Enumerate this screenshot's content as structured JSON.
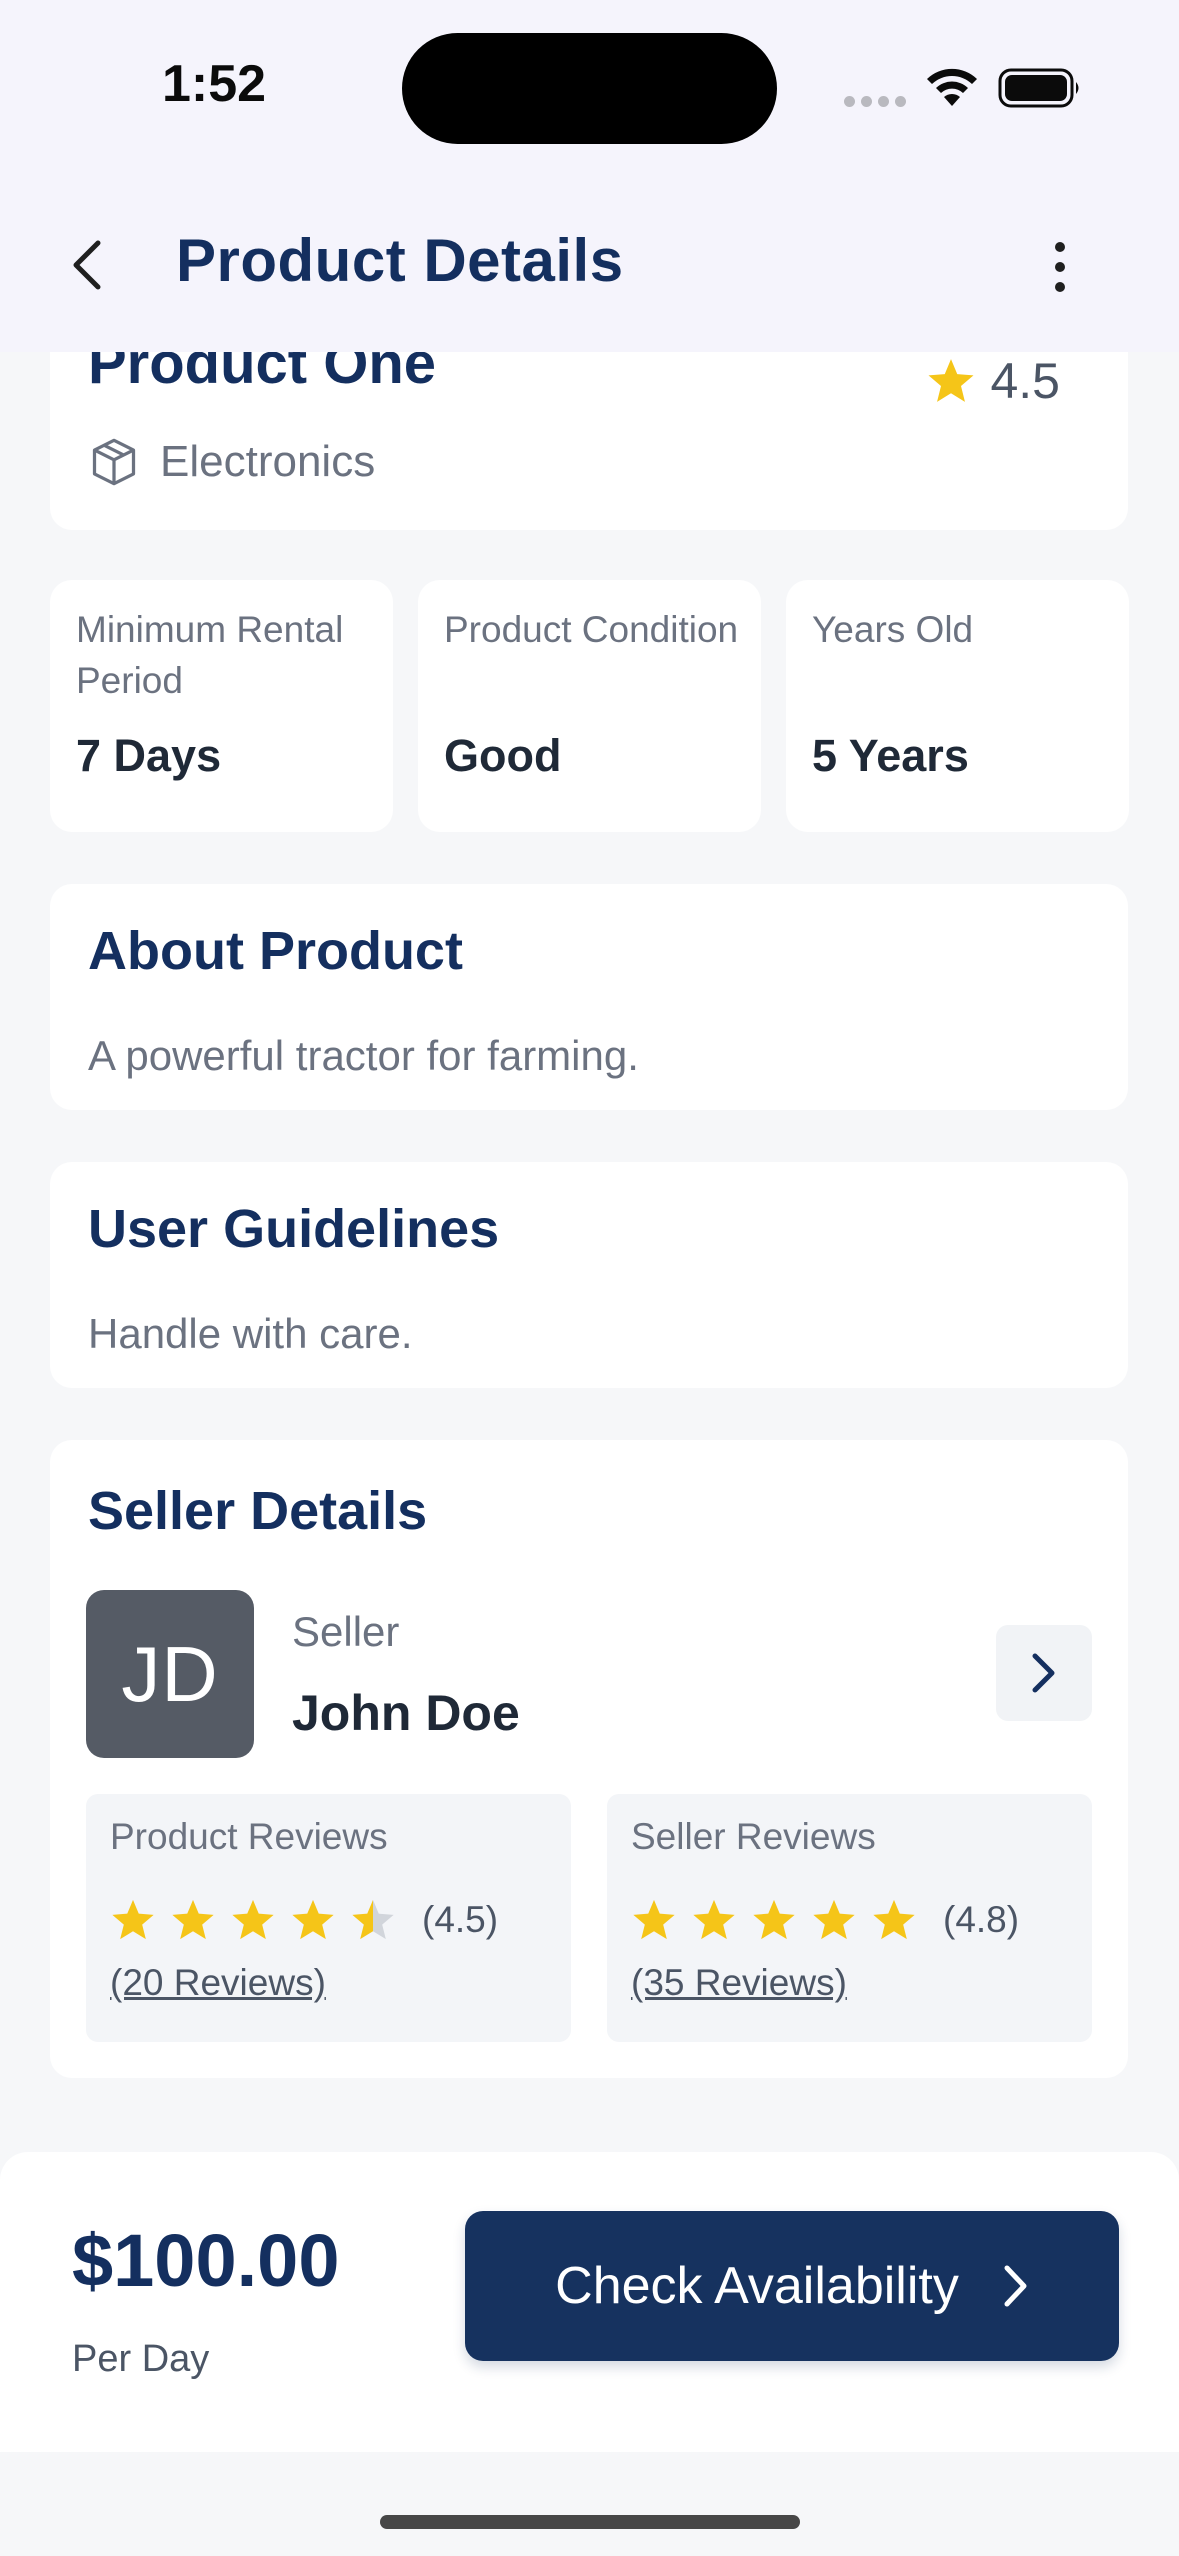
{
  "status_bar": {
    "time": "1:52"
  },
  "header": {
    "title": "Product Details",
    "back_icon": "chevron-left-icon",
    "menu_icon": "more-vertical-icon"
  },
  "product": {
    "name": "Product One",
    "rating": "4.5",
    "category": "Electronics"
  },
  "stats": [
    {
      "label": "Minimum Rental Period",
      "value": "7 Days"
    },
    {
      "label": "Product Condition",
      "value": "Good"
    },
    {
      "label": "Years Old",
      "value": "5 Years"
    }
  ],
  "about": {
    "title": "About Product",
    "text": "A powerful tractor for farming."
  },
  "guidelines": {
    "title": "User Guidelines",
    "text": "Handle with care."
  },
  "seller": {
    "title": "Seller Details",
    "initials": "JD",
    "role": "Seller",
    "name": "John Doe",
    "product_reviews": {
      "title": "Product Reviews",
      "score": "(4.5)",
      "count": "(20 Reviews)",
      "rating": 4.5
    },
    "seller_reviews": {
      "title": "Seller Reviews",
      "score": "(4.8)",
      "count": "(35 Reviews)",
      "rating": 4.8
    }
  },
  "footer": {
    "price": "$100.00",
    "unit": "Per Day",
    "cta_label": "Check Availability"
  },
  "colors": {
    "primary": "#16325f",
    "star": "#f5c518",
    "star_empty": "#d1d5db"
  }
}
